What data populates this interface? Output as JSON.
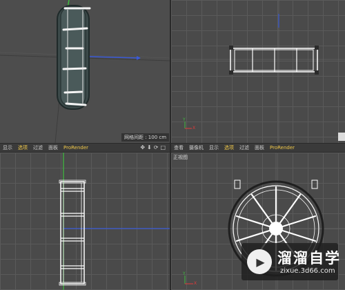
{
  "viewports": {
    "perspective": {
      "grid_spacing_label": "网格间距 : 100 cm"
    },
    "right": {
      "label": ""
    },
    "front": {
      "label": "正视图"
    }
  },
  "menubar_left": {
    "items": [
      "显示",
      "选项",
      "过滤",
      "面板",
      "ProRender"
    ],
    "active": "选项",
    "nav_icons": [
      "move-icon",
      "down-arrow-icon",
      "rotate-icon",
      "square-icon"
    ]
  },
  "menubar_right": {
    "items": [
      "查看",
      "摄像机",
      "显示",
      "选项",
      "过滤",
      "面板",
      "ProRender"
    ],
    "active": "选项"
  },
  "axes": {
    "x_label": "X",
    "y_label": "Y",
    "z_label": "Z"
  },
  "watermark": {
    "title": "溜溜自学",
    "subtitle": "zixue.3d66.com"
  },
  "colors": {
    "grid_bg": "#4a4a4a",
    "grid_line": "#5a5a5a",
    "wire": "#ffffff",
    "menu_active": "#f1c94a",
    "axis_x": "#e23a3a",
    "axis_y": "#3fbf3f",
    "axis_z": "#3a5ad8"
  }
}
